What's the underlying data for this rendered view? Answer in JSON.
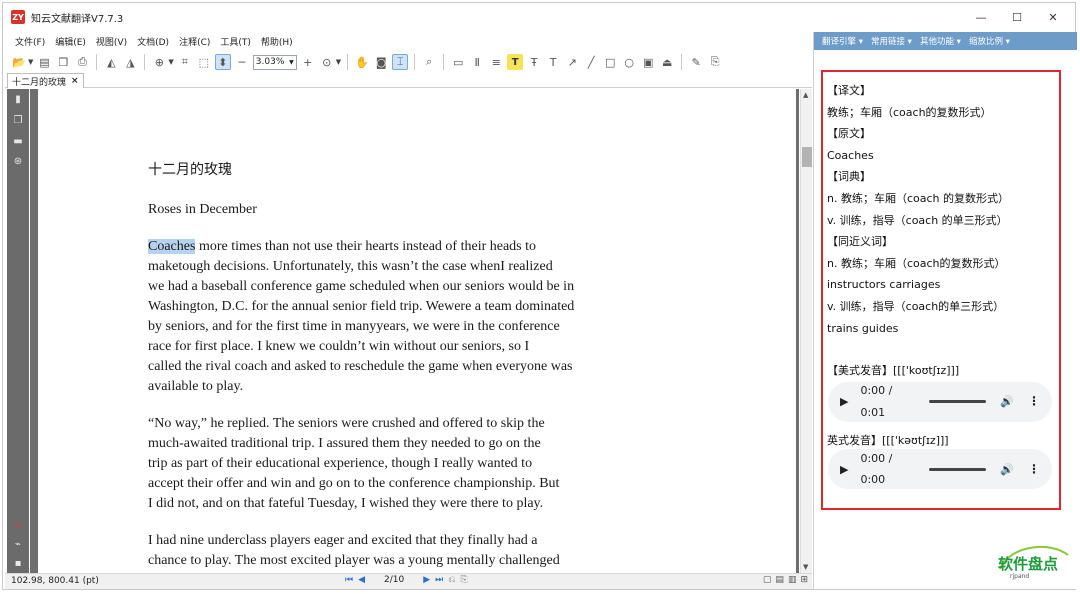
{
  "window": {
    "app_icon_text": "ZY",
    "title": "知云文献翻译V7.7.3",
    "controls": {
      "minimize": "—",
      "maximize": "☐",
      "close": "✕"
    }
  },
  "menubar": {
    "items": [
      "文件(F)",
      "编辑(E)",
      "视图(V)",
      "文档(D)",
      "注释(C)",
      "工具(T)",
      "帮助(H)"
    ]
  },
  "toolbar": {
    "zoom_value": "3.03%",
    "icons": [
      "open-folder-icon",
      "save-icon",
      "copy-icon",
      "print-icon",
      "rotate-left-icon",
      "rotate-right-icon",
      "zoom-in-icon",
      "crop-icon",
      "fit-page-icon",
      "fit-width-icon",
      "zoom-out-icon",
      "hand-tool-icon",
      "snapshot-icon",
      "select-tool-icon",
      "search-icon",
      "note-icon",
      "text-box-icon",
      "stamp-icon",
      "highlight-icon",
      "strikeout-icon",
      "underline-icon",
      "arrow-icon",
      "line-icon",
      "rectangle-icon",
      "ellipse-icon",
      "file-attach-icon",
      "signature-icon",
      "edit-icon",
      "sign-icon"
    ],
    "highlight_label": "T"
  },
  "tabs": {
    "doc_tab": "十二月的玫瑰",
    "close": "×"
  },
  "document": {
    "title_cn": "十二月的玫瑰",
    "title_en": "Roses in December",
    "highlight_word": "Coaches",
    "p1_line1_rest": " more times than not use their hearts instead of their heads to",
    "p1_lines": [
      "maketough decisions.    Unfortunately,     this   wasn’t    the  case  whenI  realized",
      "we had a baseball      conference game    scheduled when our seniors would        be in",
      "Washington,  D.C.  for  the  annual  senior   field   trip.   Wewere a team dominated",
      "by seniors,     and  for  the  first    time  in  manyyears,    we were  in  the  conference",
      "race for first place. I knew we couldn’t win without our seniors, so I",
      "called    the  rival    coach  and asked  to  reschedule    the  game when everyone   was",
      "available to play."
    ],
    "p2_lines": [
      "“No way,” he replied.           The seniors were      crushed   and offered to      skip the",
      "much-awaited traditional trip. I assured them they needed to go on the",
      "trip as part of their educational experience, though I really wanted to",
      "accept their offer and          win and go   on to the     conference championship. But",
      "I  did  not,   and  on  that   fateful    Tuesday,  I  wished  they  were  there   to  play."
    ],
    "p3_lines": [
      "I had nine underclass players eager and excited that they finally had a",
      "chance to play. The most excited player was a young mentally challenged"
    ]
  },
  "statusbar": {
    "coords": "102.98, 800.41 (pt)",
    "page_indicator": "2/10"
  },
  "translation_pane": {
    "toolbar": [
      "翻译引擎 ▾",
      "常用链接 ▾",
      "其他功能 ▾",
      "缩放比例 ▾"
    ],
    "lines": [
      "【译文】",
      "教练；车厢（coach的复数形式）",
      "【原文】",
      "Coaches",
      "【词典】",
      "n. 教练；车厢（coach 的复数形式）",
      "v. 训练，指导（coach 的单三形式）",
      "【同近义词】",
      "n. 教练；车厢（coach的复数形式）",
      "instructors  carriages",
      "v. 训练，指导（coach的单三形式）",
      "trains  guides"
    ],
    "us_pron_label": "【美式发音】[[['koʊtʃɪz]]]",
    "us_audio_time": "0:00 / 0:01",
    "uk_pron_label": "英式发音】[[['kəʊtʃɪz]]]",
    "uk_audio_time": "0:00 / 0:00"
  },
  "watermark": {
    "text": "软件盘点",
    "sub": "rjpand"
  },
  "colors": {
    "highlight": "#b7d2ee",
    "pane_header": "#6d9cc9",
    "frame_border": "#e0272b",
    "watermark": "#1f9b3e"
  }
}
